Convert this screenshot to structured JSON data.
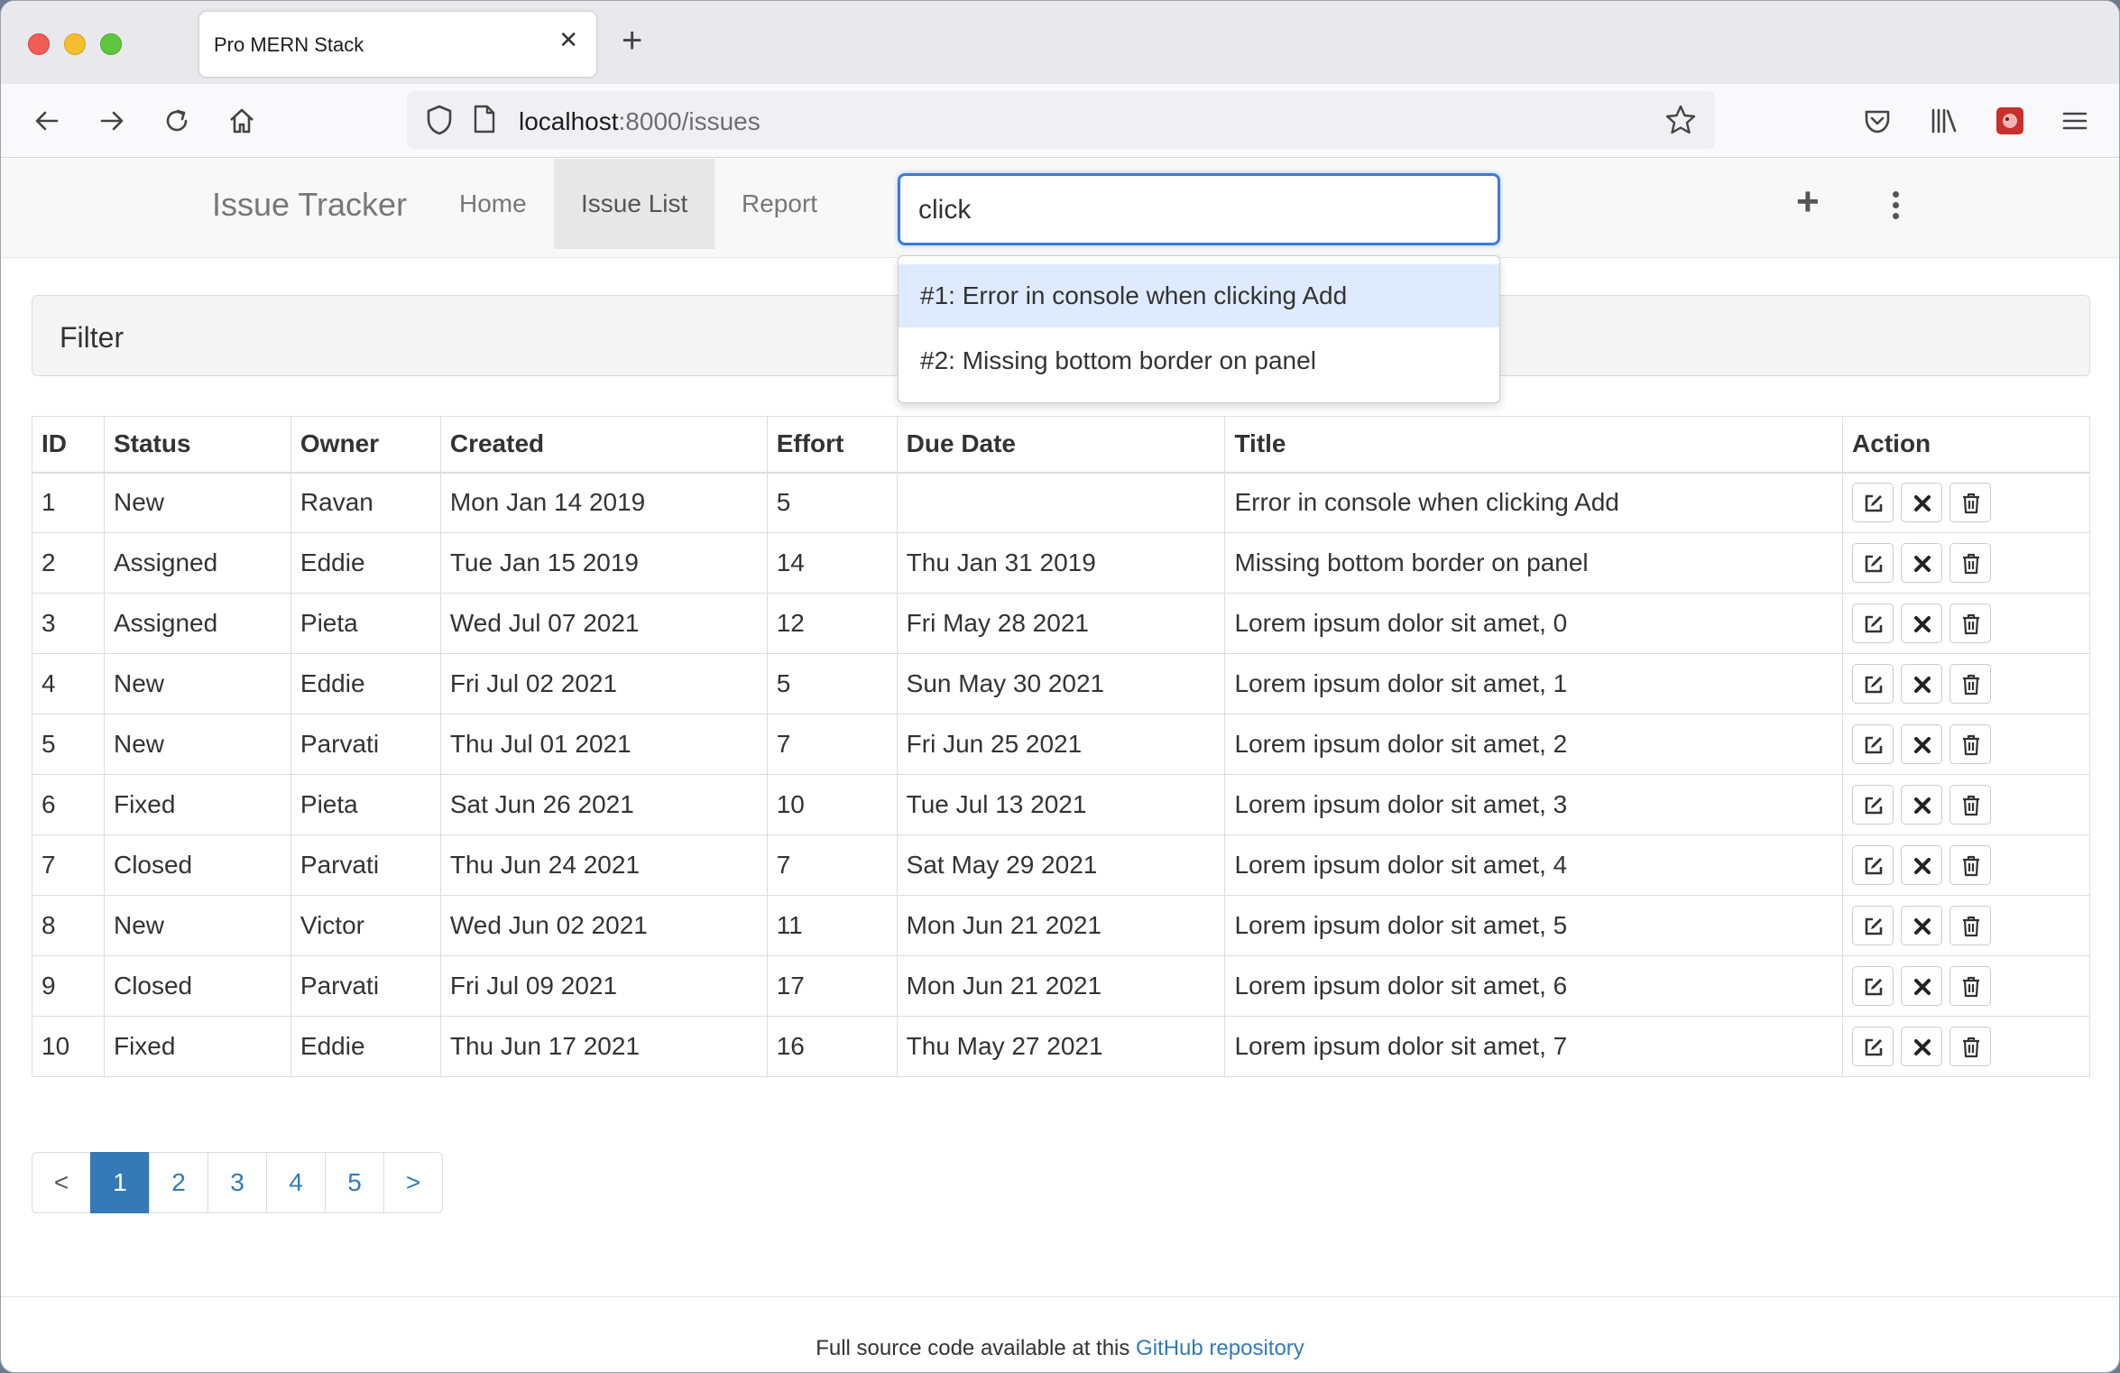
{
  "browser": {
    "tab_title": "Pro MERN Stack",
    "tab_close": "✕",
    "new_tab": "+",
    "url_host": "localhost",
    "url_rest": ":8000/issues"
  },
  "app": {
    "brand": "Issue Tracker",
    "nav": [
      "Home",
      "Issue List",
      "Report"
    ],
    "active_nav": "Issue List",
    "search_value": "click",
    "add_label": "+"
  },
  "search_results": [
    "#1: Error in console when clicking Add",
    "#2: Missing bottom border on panel"
  ],
  "filter": {
    "title": "Filter"
  },
  "table": {
    "headers": [
      "ID",
      "Status",
      "Owner",
      "Created",
      "Effort",
      "Due Date",
      "Title",
      "Action"
    ],
    "rows": [
      [
        "1",
        "New",
        "Ravan",
        "Mon Jan 14 2019",
        "5",
        "",
        "Error in console when clicking Add"
      ],
      [
        "2",
        "Assigned",
        "Eddie",
        "Tue Jan 15 2019",
        "14",
        "Thu Jan 31 2019",
        "Missing bottom border on panel"
      ],
      [
        "3",
        "Assigned",
        "Pieta",
        "Wed Jul 07 2021",
        "12",
        "Fri May 28 2021",
        "Lorem ipsum dolor sit amet, 0"
      ],
      [
        "4",
        "New",
        "Eddie",
        "Fri Jul 02 2021",
        "5",
        "Sun May 30 2021",
        "Lorem ipsum dolor sit amet, 1"
      ],
      [
        "5",
        "New",
        "Parvati",
        "Thu Jul 01 2021",
        "7",
        "Fri Jun 25 2021",
        "Lorem ipsum dolor sit amet, 2"
      ],
      [
        "6",
        "Fixed",
        "Pieta",
        "Sat Jun 26 2021",
        "10",
        "Tue Jul 13 2021",
        "Lorem ipsum dolor sit amet, 3"
      ],
      [
        "7",
        "Closed",
        "Parvati",
        "Thu Jun 24 2021",
        "7",
        "Sat May 29 2021",
        "Lorem ipsum dolor sit amet, 4"
      ],
      [
        "8",
        "New",
        "Victor",
        "Wed Jun 02 2021",
        "11",
        "Mon Jun 21 2021",
        "Lorem ipsum dolor sit amet, 5"
      ],
      [
        "9",
        "Closed",
        "Parvati",
        "Fri Jul 09 2021",
        "17",
        "Mon Jun 21 2021",
        "Lorem ipsum dolor sit amet, 6"
      ],
      [
        "10",
        "Fixed",
        "Eddie",
        "Thu Jun 17 2021",
        "16",
        "Thu May 27 2021",
        "Lorem ipsum dolor sit amet, 7"
      ]
    ]
  },
  "pagination": {
    "prev": "<",
    "pages": [
      "1",
      "2",
      "3",
      "4",
      "5"
    ],
    "active": "1",
    "next": ">"
  },
  "footer": {
    "text": "Full source code available at this ",
    "link": "GitHub repository"
  },
  "colors": {
    "accent": "#337ab7",
    "focus_ring": "#3b7bd8",
    "highlight": "#deebff"
  }
}
